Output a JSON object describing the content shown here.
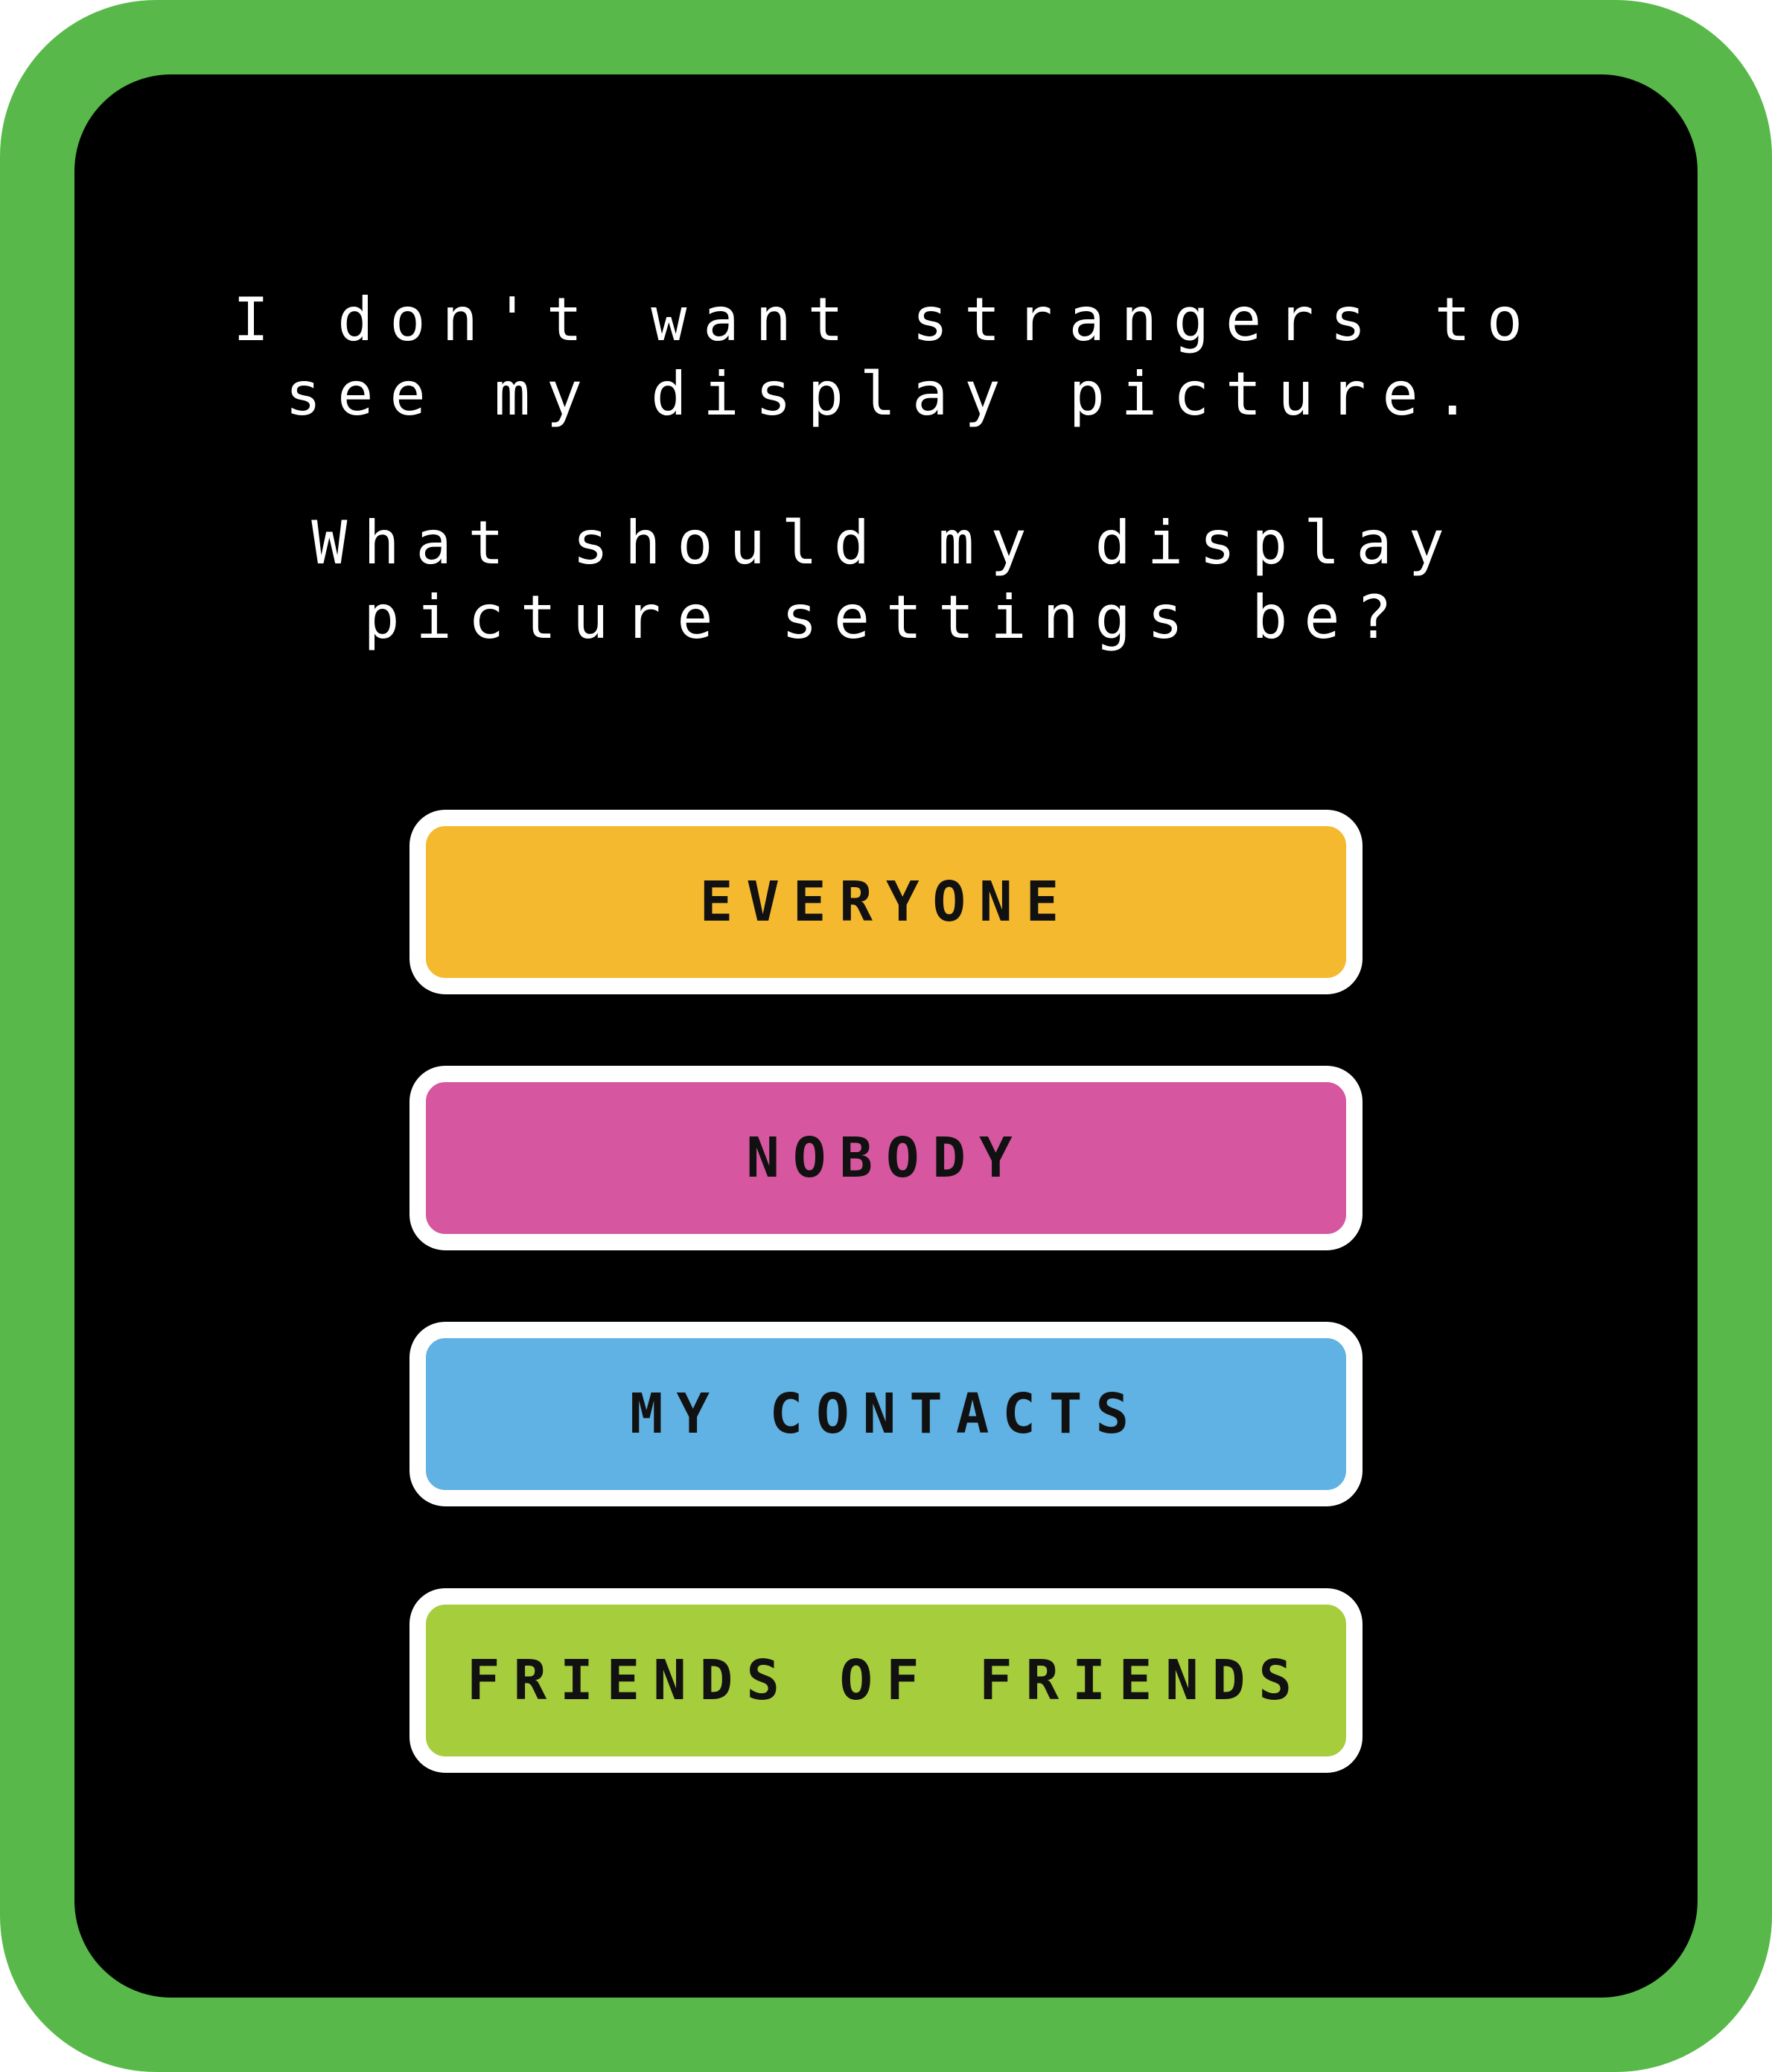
{
  "question": {
    "line1": "I don't want strangers to see my display picture.",
    "line2": "What should my display picture settings be?"
  },
  "options": [
    {
      "label": "EVERYONE",
      "color": "#f5b92f"
    },
    {
      "label": "NOBODY",
      "color": "#d6569f"
    },
    {
      "label": "MY CONTACTS",
      "color": "#5fb2e3"
    },
    {
      "label": "FRIENDS OF FRIENDS",
      "color": "#a6cd3b"
    }
  ],
  "colors": {
    "frame": "#58b94a",
    "screen": "#000000",
    "text": "#ffffff",
    "option_border": "#ffffff"
  }
}
